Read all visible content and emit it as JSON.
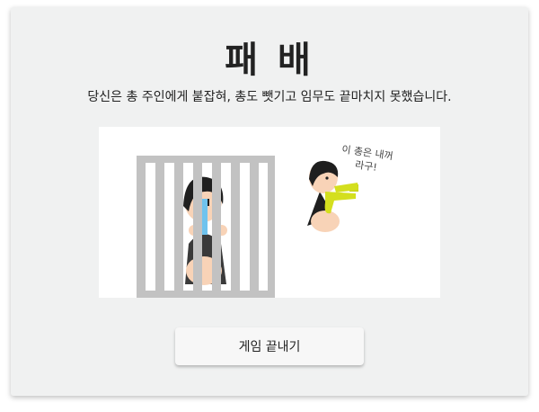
{
  "result": {
    "title": "패 배",
    "message": "당신은 총 주인에게 붙잡혀, 총도 뺏기고 임무도 끝마치지 못했습니다."
  },
  "illustration": {
    "speech_line1": "이 총은 내꺼",
    "speech_line2": "라구!"
  },
  "actions": {
    "end_game_label": "게임 끝내기"
  },
  "colors": {
    "card_bg": "#f0f1f1",
    "bars": "#c2c2c2",
    "tears": "#6fc3ee",
    "gun": "#d4df1e",
    "skin": "#f8d3b7",
    "hair": "#1f1f1f"
  }
}
